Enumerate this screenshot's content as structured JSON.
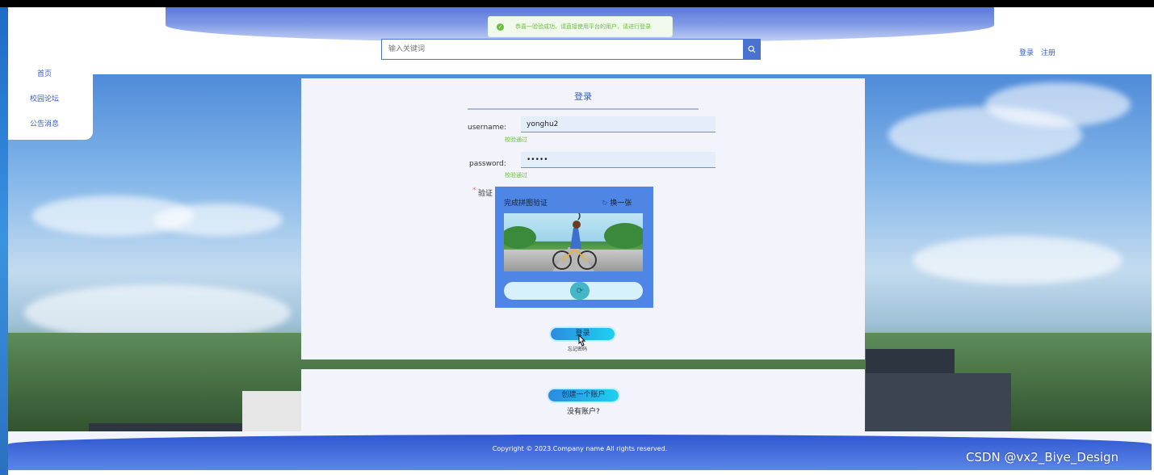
{
  "header": {
    "toast_message": "恭喜一验验成功，请直接使用平台的用户，请进行登录",
    "search_placeholder": "输入关键词",
    "login_link": "登录",
    "register_link": "注册"
  },
  "sidebar": {
    "items": [
      {
        "label": "首页"
      },
      {
        "label": "校园论坛"
      },
      {
        "label": "公告消息"
      }
    ]
  },
  "login_form": {
    "title": "登录",
    "username_label": "username:",
    "username_value": "yonghu2",
    "username_hint": "校验通过",
    "password_label": "password:",
    "password_value": "•••••",
    "password_hint": "校验通过",
    "captcha_label": "验证",
    "captcha_required_mark": "*",
    "captcha_title": "完成拼图验证",
    "captcha_refresh": "换一张",
    "login_button": "登录",
    "forgot_link": "忘记密码"
  },
  "register_panel": {
    "create_button": "创建一个账户",
    "no_account_text": "没有账户?"
  },
  "footer": {
    "copyright": "Copyright © 2023.Company name All rights reserved."
  },
  "watermark": "CSDN @vx2_Biye_Design",
  "colors": {
    "primary": "#4a73d1",
    "success": "#67c23a",
    "panel_bg": "#f2f3fb",
    "captcha_bg": "#4f86e6"
  }
}
